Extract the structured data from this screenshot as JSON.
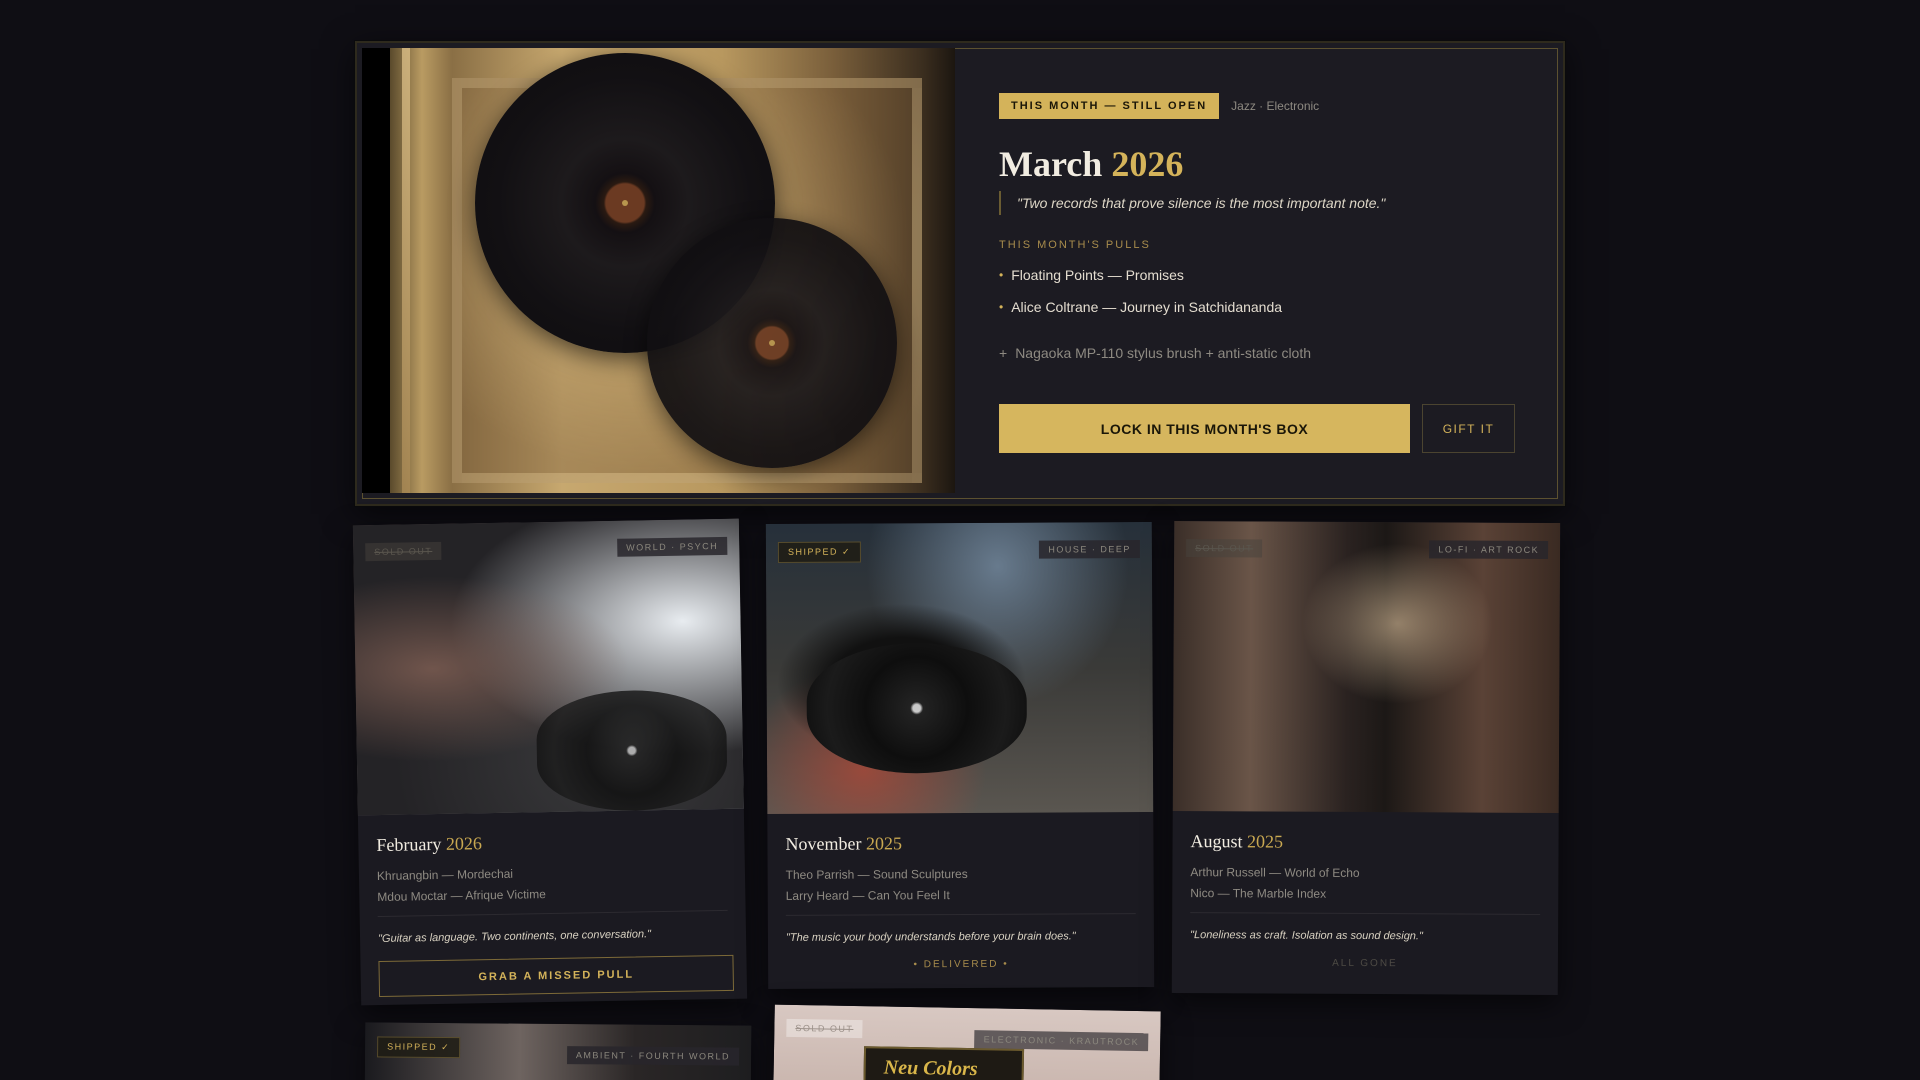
{
  "hero": {
    "badge": "THIS MONTH — STILL OPEN",
    "genres": "Jazz · Electronic",
    "month": "March",
    "year": "2026",
    "quote": "\"Two records that prove silence is the most important note.\"",
    "pulls_label": "THIS MONTH'S PULLS",
    "pulls": [
      "Floating Points — Promises",
      "Alice Coltrane — Journey in Satchidananda"
    ],
    "extra": "Nagaoka MP-110 stylus brush + anti-static cloth",
    "primary_button": "LOCK IN THIS MONTH'S BOX",
    "secondary_button": "GIFT IT"
  },
  "cards": [
    {
      "month": "February",
      "year": "2026",
      "tag_left": "SOLD OUT",
      "tag_right": "WORLD · PSYCH",
      "pulls": [
        "Khruangbin — Mordechai",
        "Mdou Moctar — Afrique Victime"
      ],
      "quote": "\"Guitar as language. Two continents, one conversation.\"",
      "action": "GRAB A MISSED PULL"
    },
    {
      "month": "November",
      "year": "2025",
      "tag_left": "SHIPPED ✓",
      "tag_right": "HOUSE · DEEP",
      "pulls": [
        "Theo Parrish — Sound Sculptures",
        "Larry Heard — Can You Feel It"
      ],
      "quote": "\"The music your body understands before your brain does.\"",
      "status": "• DELIVERED •"
    },
    {
      "month": "August",
      "year": "2025",
      "tag_left": "SOLD OUT",
      "tag_right": "LO-FI · ART ROCK",
      "pulls": [
        "Arthur Russell — World of Echo",
        "Nico — The Marble Index"
      ],
      "quote": "\"Loneliness as craft. Isolation as sound design.\"",
      "status": "ALL GONE"
    }
  ],
  "bottom_cards": [
    {
      "tag_left": "SHIPPED ✓",
      "tag_right": "AMBIENT · FOURTH WORLD"
    },
    {
      "tag_left": "SOLD OUT",
      "tag_right": "ELECTRONIC · KRAUTROCK",
      "art_text": "Neu Colors"
    }
  ]
}
